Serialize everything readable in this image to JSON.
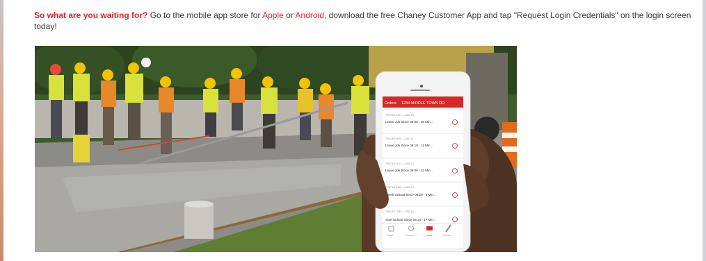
{
  "intro": {
    "lead": "So what are you waiting for?",
    "part1": " Go to the mobile app store for ",
    "apple_link": "Apple",
    "part2": " or ",
    "android_link": "Android",
    "part3": ", download the free Chaney Customer App and tap \"Request Login Credentials\" on the login screen today!"
  },
  "phone": {
    "header_tab": "Orders",
    "header_title": "1234 MIDDLE TOWN RD",
    "orders": [
      {
        "sub": "TRUCKS 1234 - LOAD 10",
        "status": "Leave Job Since 09:05 - 36 Min..."
      },
      {
        "sub": "TRUCKS 5678 - LOAD 11",
        "status": "Leave Job Since 09:19 - 12 Min..."
      },
      {
        "sub": "TRUCKS 9012 - LOAD 12",
        "status": "Leave Job Since 09:09 - 22 Min..."
      },
      {
        "sub": "TRUCKS 3456 - LOAD 13",
        "status": "Finish Unload Since 09:28 - 3 Min..."
      },
      {
        "sub": "TRUCKS 7890 - LOAD 14",
        "status": "Start Unload Since 09:14 - 17 Min..."
      }
    ],
    "tabs": [
      "Orders",
      "Products",
      "Plants",
      "Settings"
    ]
  },
  "colors": {
    "accent": "#e0242a",
    "text": "#3a3a3a",
    "vest": "#d8e23a",
    "helmet": "#f2c300"
  }
}
